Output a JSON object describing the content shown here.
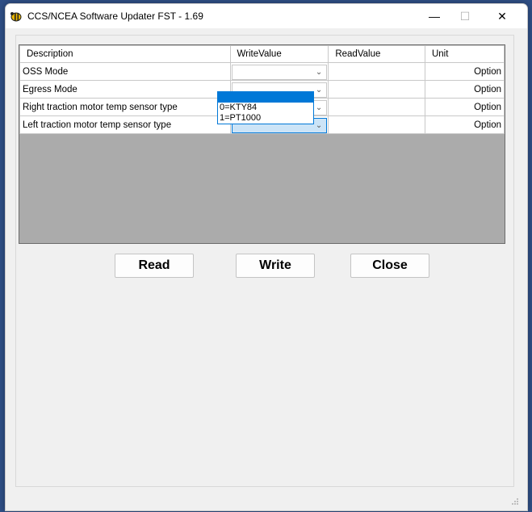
{
  "window": {
    "title": "CCS/NCEA Software Updater FST - 1.69"
  },
  "grid": {
    "columns": [
      "Description",
      "WriteValue",
      "ReadValue",
      "Unit"
    ],
    "rows": [
      {
        "description": "OSS Mode",
        "write_value": "",
        "read_value": "",
        "unit": "Option"
      },
      {
        "description": "Egress Mode",
        "write_value": "",
        "read_value": "",
        "unit": "Option"
      },
      {
        "description": "Right traction motor temp sensor type",
        "write_value": "",
        "read_value": "",
        "unit": "Option"
      },
      {
        "description": "Left traction motor temp sensor type",
        "write_value": "",
        "read_value": "",
        "unit": "Option"
      }
    ]
  },
  "dropdown": {
    "options": [
      "",
      "0=KTY84",
      "1=PT1000"
    ]
  },
  "buttons": {
    "read": "Read",
    "write": "Write",
    "close": "Close"
  },
  "colors": {
    "accent": "#0078d7",
    "grid_background": "#ababab"
  }
}
